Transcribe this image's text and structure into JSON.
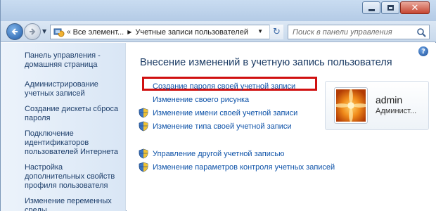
{
  "address_bar": {
    "chevrons": "«",
    "crumb_1": "Все элемент...",
    "crumb_2": "Учетные записи пользователей"
  },
  "search": {
    "placeholder": "Поиск в панели управления"
  },
  "sidebar": {
    "home": "Панель управления - домашняя страница",
    "tasks": [
      {
        "label": "Администрирование учетных записей"
      },
      {
        "label": "Создание дискеты сброса пароля"
      },
      {
        "label": "Подключение идентификаторов пользователей Интернета"
      },
      {
        "label": "Настройка дополнительных свойств профиля пользователя"
      },
      {
        "label": "Изменение переменных среды"
      }
    ]
  },
  "main": {
    "title": "Внесение изменений в учетную запись пользователя",
    "links": [
      {
        "label": "Создание пароля своей учетной записи",
        "shield": false
      },
      {
        "label": "Изменение своего рисунка",
        "shield": false
      },
      {
        "label": "Изменение имени своей учетной записи",
        "shield": true
      },
      {
        "label": "Изменение типа своей учетной записи",
        "shield": true
      }
    ],
    "links_secondary": [
      {
        "label": "Управление другой учетной записью",
        "shield": true
      },
      {
        "label": "Изменение параметров контроля учетных записей",
        "shield": true
      }
    ],
    "help_glyph": "?"
  },
  "user": {
    "name": "admin",
    "role": "Админист..."
  },
  "colors": {
    "highlight": "#d01010",
    "link": "#0d52a8",
    "title": "#1a3a63"
  }
}
